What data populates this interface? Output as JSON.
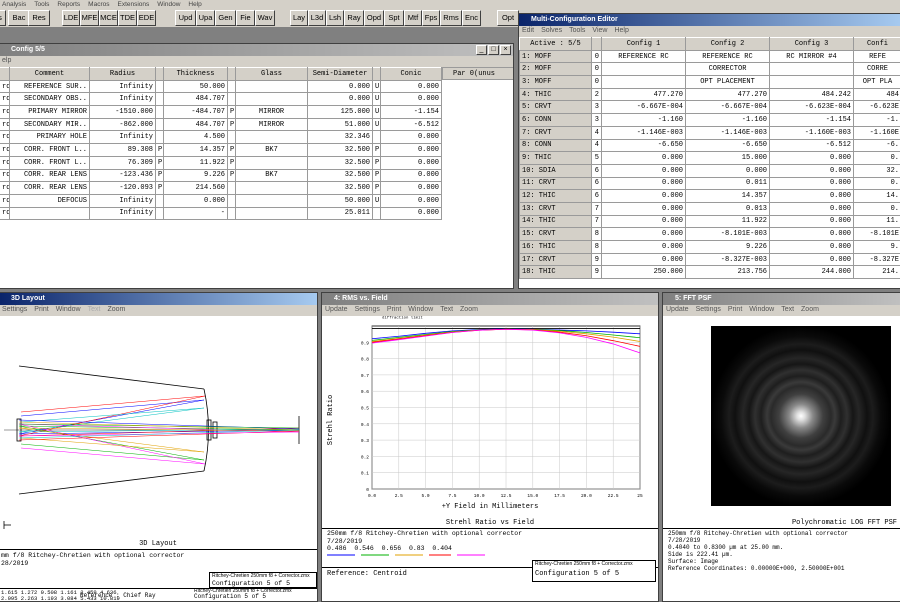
{
  "menubar": [
    "Analysis",
    "Tools",
    "Reports",
    "Macros",
    "Extensions",
    "Window",
    "Help"
  ],
  "toolbar": [
    "s",
    "Bac",
    "Res",
    "LDE",
    "MFE",
    "MCE",
    "TDE",
    "EDE",
    "Upd",
    "Upa",
    "Gen",
    "Fie",
    "Wav",
    "Lay",
    "L3d",
    "Lsh",
    "Ray",
    "Opd",
    "Spt",
    "Mtf",
    "Fps",
    "Rms",
    "Enc",
    "Opt"
  ],
  "lde": {
    "title": "Config 5/5",
    "menu": [
      "elp"
    ],
    "headers": [
      "Comment",
      "Radius",
      "Thickness",
      "Glass",
      "Semi-Diameter",
      "Conic",
      "Par 0(unus"
    ],
    "rows": [
      {
        "type": "rd",
        "comment": "REFERENCE SUR..",
        "radius": "Infinity",
        "rflag": "",
        "thickness": "50.000",
        "tflag": "",
        "glass": "",
        "semi": "0.000",
        "sflag": "U",
        "conic": "0.000",
        "style": "w"
      },
      {
        "type": "rd",
        "comment": "SECONDARY OBS..",
        "radius": "Infinity",
        "rflag": "",
        "thickness": "484.707",
        "tflag": "",
        "glass": "",
        "semi": "0.000",
        "sflag": "U",
        "conic": "0.000",
        "style": "w"
      },
      {
        "type": "rd",
        "comment": "PRIMARY MIRROR",
        "radius": "-1510.000",
        "rflag": "",
        "thickness": "-484.707",
        "tflag": "P",
        "glass": "MIRROR",
        "semi": "125.000",
        "sflag": "U",
        "conic": "-1.154",
        "style": "g"
      },
      {
        "type": "rd",
        "comment": "SECONDARY MIR..",
        "radius": "-862.000",
        "rflag": "",
        "thickness": "484.707",
        "tflag": "P",
        "glass": "MIRROR",
        "semi": "51.000",
        "sflag": "U",
        "conic": "-6.512",
        "style": "g"
      },
      {
        "type": "rd",
        "comment": "PRIMARY HOLE",
        "radius": "Infinity",
        "rflag": "",
        "thickness": "4.500",
        "tflag": "",
        "glass": "",
        "semi": "32.346",
        "sflag": "",
        "conic": "0.000",
        "style": "w"
      },
      {
        "type": "rd",
        "comment": "CORR. FRONT L..",
        "radius": "89.308",
        "rflag": "P",
        "thickness": "14.357",
        "tflag": "P",
        "glass": "BK7",
        "semi": "32.500",
        "sflag": "P",
        "conic": "0.000",
        "style": "p"
      },
      {
        "type": "rd",
        "comment": "CORR. FRONT L..",
        "radius": "76.309",
        "rflag": "P",
        "thickness": "11.922",
        "tflag": "P",
        "glass": "",
        "semi": "32.500",
        "sflag": "P",
        "conic": "0.000",
        "style": "w"
      },
      {
        "type": "rd",
        "comment": "CORR. REAR LENS",
        "radius": "-123.436",
        "rflag": "P",
        "thickness": "9.226",
        "tflag": "P",
        "glass": "BK7",
        "semi": "32.500",
        "sflag": "P",
        "conic": "0.000",
        "style": "p"
      },
      {
        "type": "rd",
        "comment": "CORR. REAR LENS",
        "radius": "-120.093",
        "rflag": "P",
        "thickness": "214.560",
        "tflag": "",
        "glass": "",
        "semi": "32.500",
        "sflag": "P",
        "conic": "0.000",
        "style": "w"
      },
      {
        "type": "rd",
        "comment": "DEFOCUS",
        "radius": "Infinity",
        "rflag": "",
        "thickness": "0.000",
        "tflag": "",
        "glass": "",
        "semi": "50.000",
        "sflag": "U",
        "conic": "0.000",
        "style": "w"
      },
      {
        "type": "rd",
        "comment": "",
        "radius": "Infinity",
        "rflag": "",
        "thickness": "-",
        "tflag": "",
        "glass": "",
        "semi": "25.011",
        "sflag": "",
        "conic": "0.000",
        "style": "w"
      }
    ]
  },
  "mce": {
    "title": "Multi-Configuration Editor",
    "menu": [
      "Edit",
      "Solves",
      "Tools",
      "View",
      "Help"
    ],
    "headers": [
      "Active : 5/5",
      "",
      "Config 1",
      "Config 2",
      "Config 3",
      "Confi"
    ],
    "rows": [
      {
        "op": "1: MOFF",
        "n": "0",
        "c1": "REFERENCE RC",
        "c2": "REFERENCE RC",
        "c3": "RC MIRROR #4",
        "c4": "REFE",
        "style": "white",
        "align": "c"
      },
      {
        "op": "2: MOFF",
        "n": "0",
        "c1": "",
        "c2": "CORRECTOR",
        "c3": "",
        "c4": "CORRE",
        "style": "white",
        "align": "c"
      },
      {
        "op": "3: MOFF",
        "n": "0",
        "c1": "",
        "c2": "OPT PLACEMENT",
        "c3": "",
        "c4": "OPT PLA",
        "style": "white",
        "align": "c"
      },
      {
        "op": "4: THIC",
        "n": "2",
        "c1": "477.270",
        "c2": "477.270",
        "c3": "484.242",
        "c4": "484",
        "style": "white",
        "align": "r"
      },
      {
        "op": "5: CRVT",
        "n": "3",
        "c1": "-6.667E-004",
        "c2": "-6.667E-004",
        "c3": "-6.623E-004",
        "c4": "-6.623E",
        "style": "yellow",
        "align": "r"
      },
      {
        "op": "6: CONN",
        "n": "3",
        "c1": "-1.160",
        "c2": "-1.160",
        "c3": "-1.154",
        "c4": "-1.",
        "style": "green",
        "align": "r"
      },
      {
        "op": "7: CRVT",
        "n": "4",
        "c1": "-1.146E-003",
        "c2": "-1.146E-003",
        "c3": "-1.160E-003",
        "c4": "-1.160E",
        "style": "yellow",
        "align": "r"
      },
      {
        "op": "8: CONN",
        "n": "4",
        "c1": "-6.650",
        "c2": "-6.650",
        "c3": "-6.512",
        "c4": "-6.",
        "style": "green",
        "align": "r"
      },
      {
        "op": "9: THIC",
        "n": "5",
        "c1": "0.000",
        "c2": "15.000",
        "c3": "0.000",
        "c4": "0.",
        "style": "red",
        "align": "r"
      },
      {
        "op": "10: SDIA",
        "n": "6",
        "c1": "0.000",
        "c2": "0.000",
        "c3": "0.000",
        "c4": "32.",
        "style": "blue",
        "align": "r"
      },
      {
        "op": "11: CRVT",
        "n": "6",
        "c1": "0.000",
        "c2": "0.011",
        "c3": "0.000",
        "c4": "0.",
        "style": "yellow",
        "align": "r"
      },
      {
        "op": "12: THIC",
        "n": "6",
        "c1": "0.000",
        "c2": "14.357",
        "c3": "0.000",
        "c4": "14.",
        "style": "blue",
        "align": "r"
      },
      {
        "op": "13: CRVT",
        "n": "7",
        "c1": "0.000",
        "c2": "0.013",
        "c3": "0.000",
        "c4": "0.",
        "style": "yellow",
        "align": "r"
      },
      {
        "op": "14: THIC",
        "n": "7",
        "c1": "0.000",
        "c2": "11.922",
        "c3": "0.000",
        "c4": "11.",
        "style": "white",
        "align": "r"
      },
      {
        "op": "15: CRVT",
        "n": "8",
        "c1": "0.000",
        "c2": "-8.101E-003",
        "c3": "0.000",
        "c4": "-8.101E",
        "style": "yellow",
        "align": "r"
      },
      {
        "op": "16: THIC",
        "n": "8",
        "c1": "0.000",
        "c2": "9.226",
        "c3": "0.000",
        "c4": "9.",
        "style": "blue",
        "align": "r"
      },
      {
        "op": "17: CRVT",
        "n": "9",
        "c1": "0.000",
        "c2": "-8.327E-003",
        "c3": "0.000",
        "c4": "-8.327E",
        "style": "yellow",
        "align": "r"
      },
      {
        "op": "18: THIC",
        "n": "9",
        "c1": "250.000",
        "c2": "213.756",
        "c3": "244.000",
        "c4": "214.",
        "style": "red",
        "align": "r"
      }
    ]
  },
  "layout3d": {
    "title": "3D Layout",
    "menu": [
      "Settings",
      "Print",
      "Window",
      "Text",
      "Zoom"
    ],
    "caption": "3D Layout",
    "info1": "mm f/8 Ritchey-Chretien with optional corrector",
    "info2": "28/2019",
    "file": "Ritchey-Chretien 250mm f8 + Corrector.zmx",
    "config": "Configuration 5 of 5",
    "table_rows": [
      "1.615     1.272     0.508     1.161     2.459     4.636",
      "2.095     2.263     1.193     3.084     5.433    10.819"
    ],
    "ref": "Reference  : Chief Ray",
    "file2": "Ritchey-Chretien 250mm f8 + Corrector.zmx",
    "config2": "Configuration 5 of 5"
  },
  "rms": {
    "title": "4: RMS vs. Field",
    "menu": [
      "Update",
      "Settings",
      "Print",
      "Window",
      "Text",
      "Zoom"
    ],
    "caption": "Strehl Ratio vs Field",
    "ylabel": "Strehl Ratio",
    "xlabel": "+Y Field in Millimeters",
    "diff_label": "diffraction limit",
    "info1": "250mm f/8 Ritchey-Chretien with optional corrector",
    "info2": "7/28/2019",
    "legend_nums": [
      "0.486",
      "0.546",
      "0.656",
      "0.83",
      "0.404"
    ],
    "ref": "Reference: Centroid",
    "file": "Ritchey-Chretien 250mm f8 + Corrector.zmx",
    "config": "Configuration 5 of 5"
  },
  "psf": {
    "title": "5: FFT PSF",
    "menu": [
      "Update",
      "Settings",
      "Print",
      "Window",
      "Text",
      "Zoom"
    ],
    "caption": "Polychromatic LOG FFT PSF",
    "info": [
      "250mm f/8 Ritchey-Chretien with optional corrector",
      "7/28/2019",
      "0.4040 to 0.8300 µm at 25.00 mm.",
      "Side is 222.41 µm.",
      "Surface: Image",
      "Reference Coordinates: 0.00000E+000, 2.50000E+001"
    ]
  },
  "chart_data": {
    "type": "line",
    "title": "Strehl Ratio vs Field",
    "xlabel": "+Y Field in Millimeters",
    "ylabel": "Strehl Ratio",
    "x_ticks": [
      "0.0",
      "2.5",
      "5.0",
      "7.5",
      "10.0",
      "12.5",
      "15.0",
      "17.5",
      "20.0",
      "22.5",
      "25"
    ],
    "y_ticks": [
      "0",
      "0.1",
      "0.2",
      "0.3",
      "0.4",
      "0.5",
      "0.6",
      "0.7",
      "0.8",
      "0.9"
    ],
    "xlim": [
      0,
      25
    ],
    "ylim": [
      0,
      1
    ],
    "x": [
      0,
      2.5,
      5,
      7.5,
      10,
      12.5,
      15,
      17.5,
      20,
      22.5,
      25
    ],
    "series": [
      {
        "color": "#0000ff",
        "values": [
          0.922,
          0.937,
          0.955,
          0.97,
          0.978,
          0.982,
          0.98,
          0.975,
          0.97,
          0.962,
          0.952
        ]
      },
      {
        "color": "#00b000",
        "values": [
          0.912,
          0.93,
          0.948,
          0.966,
          0.976,
          0.981,
          0.979,
          0.972,
          0.96,
          0.945,
          0.928
        ]
      },
      {
        "color": "#e0a000",
        "values": [
          0.905,
          0.924,
          0.944,
          0.963,
          0.975,
          0.98,
          0.978,
          0.968,
          0.952,
          0.932,
          0.905
        ]
      },
      {
        "color": "#ff0000",
        "values": [
          0.9,
          0.92,
          0.941,
          0.961,
          0.974,
          0.98,
          0.976,
          0.962,
          0.94,
          0.91,
          0.875
        ]
      },
      {
        "color": "#ff00ff",
        "values": [
          0.895,
          0.916,
          0.938,
          0.96,
          0.974,
          0.98,
          0.975,
          0.958,
          0.93,
          0.89,
          0.835
        ]
      }
    ]
  }
}
